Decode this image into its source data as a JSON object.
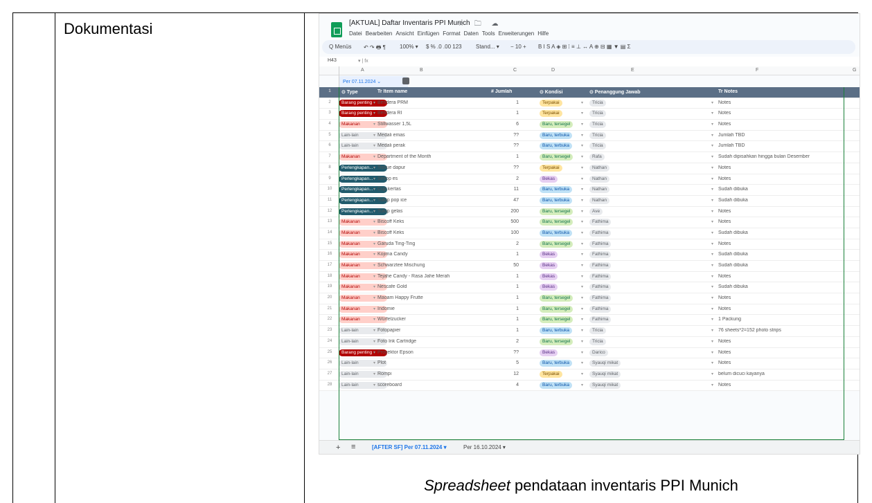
{
  "label": "Dokumentasi",
  "caption_italic": "Spreadsheet",
  "caption_rest": " pendataan inventaris PPI Munich",
  "sheet": {
    "title": "[AKTUAL] Daftar Inventaris PPI Munich",
    "title_icons": "☆ 🗀 ☁",
    "menu": [
      "Datei",
      "Bearbeiten",
      "Ansicht",
      "Einfügen",
      "Format",
      "Daten",
      "Tools",
      "Erweiterungen",
      "Hilfe"
    ],
    "toolbar": {
      "search": "Q Menüs",
      "undo": "↶ ↷ 🖶 ¶",
      "zoom": "100% ▾",
      "fmt": "$ % .0 .00 123",
      "font": "Stand... ▾",
      "size": "− 10 +",
      "style": "B I S A ◈ ⊞ ⁞ ≡ ⊥ ↔ A ⊕ ⊟ ▦ ▼ ▤ Σ"
    },
    "cell_ref": "H43",
    "fx": "▾ | fx",
    "col_letters": [
      "A",
      "B",
      "C",
      "D",
      "E",
      "F",
      "G"
    ],
    "tab_chip": "Per 07.11.2024 ⌄",
    "headers": {
      "type": "⊙ Type",
      "item": "Tr Item name",
      "jumlah": "# Jumlah",
      "kondisi": "⊙ Kondisi",
      "pj": "⊙ Penanggung Jawab",
      "notes": "Tr Notes"
    },
    "rows": [
      {
        "n": "2",
        "type": "Barang penting",
        "item": "Bendera PRM",
        "jml": "1",
        "kond": "Terpakai",
        "pj": "Tricia",
        "notes": "Notes"
      },
      {
        "n": "3",
        "type": "Barang penting",
        "item": "Bendera RI",
        "jml": "1",
        "kond": "Terpakai",
        "pj": "Tricia",
        "notes": "Notes"
      },
      {
        "n": "4",
        "type": "Makanan",
        "item": "Stillwasser 1,5L",
        "jml": "6",
        "kond": "Baru, tersegel",
        "pj": "Tricia",
        "notes": "Notes"
      },
      {
        "n": "5",
        "type": "Lain-lain",
        "item": "Medali emas",
        "jml": "??",
        "kond": "Baru, terbuka",
        "pj": "Tricia",
        "notes": "Jumlah TBD"
      },
      {
        "n": "6",
        "type": "Lain-lain",
        "item": "Medali perak",
        "jml": "??",
        "kond": "Baru, terbuka",
        "pj": "Tricia",
        "notes": "Jumlah TBD"
      },
      {
        "n": "7",
        "type": "Makanan",
        "item": "Department of the Month",
        "jml": "1",
        "kond": "Baru, tersegel",
        "pj": "Rafa",
        "notes": "Sudah dipisahkan hingga bulan Desember"
      },
      {
        "n": "8",
        "type": "Perlengkapan...",
        "item": "Tissue dapur",
        "jml": "??",
        "kond": "Terpakai",
        "pj": "Nathan",
        "notes": "Notes"
      },
      {
        "n": "9",
        "type": "Perlengkapan...",
        "item": "Sekop es",
        "jml": "2",
        "kond": "Bekas",
        "pj": "Nathan",
        "notes": "Notes"
      },
      {
        "n": "10",
        "type": "Perlengkapan...",
        "item": "Cup kertas",
        "jml": "11",
        "kond": "Baru, terbuka",
        "pj": "Nathan",
        "notes": "Sudah dibuka"
      },
      {
        "n": "11",
        "type": "Perlengkapan...",
        "item": "Tutup pop ice",
        "jml": "47",
        "kond": "Baru, terbuka",
        "pj": "Nathan",
        "notes": "Sudah dibuka"
      },
      {
        "n": "12",
        "type": "Perlengkapan...",
        "item": "Tutup gelas",
        "jml": "200",
        "kond": "Baru, tersegel",
        "pj": "Ave",
        "notes": "Notes"
      },
      {
        "n": "13",
        "type": "Makanan",
        "item": "Biscoff Keks",
        "jml": "500",
        "kond": "Baru, tersegel",
        "pj": "Fathima",
        "notes": "Notes"
      },
      {
        "n": "14",
        "type": "Makanan",
        "item": "Biscoff Keks",
        "jml": "100",
        "kond": "Baru, terbuka",
        "pj": "Fathima",
        "notes": "Sudah dibuka"
      },
      {
        "n": "15",
        "type": "Makanan",
        "item": "Garuda Ting-Ting",
        "jml": "2",
        "kond": "Baru, tersegel",
        "pj": "Fathima",
        "notes": "Notes"
      },
      {
        "n": "16",
        "type": "Makanan",
        "item": "Kojima Candy",
        "jml": "1",
        "kond": "Bekas",
        "pj": "Fathima",
        "notes": "Sudah dibuka"
      },
      {
        "n": "17",
        "type": "Makanan",
        "item": "Schwarztee Mischung",
        "jml": "50",
        "kond": "Bekas",
        "pj": "Fathima",
        "notes": "Sudah dibuka"
      },
      {
        "n": "18",
        "type": "Makanan",
        "item": "Tejahe Candy - Rasa Jahe Merah",
        "jml": "1",
        "kond": "Bekas",
        "pj": "Fathima",
        "notes": "Notes"
      },
      {
        "n": "19",
        "type": "Makanan",
        "item": "Nescafe Gold",
        "jml": "1",
        "kond": "Bekas",
        "pj": "Fathima",
        "notes": "Sudah dibuka"
      },
      {
        "n": "20",
        "type": "Makanan",
        "item": "Maoam Happy Frutte",
        "jml": "1",
        "kond": "Baru, tersegel",
        "pj": "Fathima",
        "notes": "Notes"
      },
      {
        "n": "21",
        "type": "Makanan",
        "item": "Indomie",
        "jml": "1",
        "kond": "Baru, tersegel",
        "pj": "Fathima",
        "notes": "Notes"
      },
      {
        "n": "22",
        "type": "Makanan",
        "item": "Würfelzucker",
        "jml": "1",
        "kond": "Baru, tersegel",
        "pj": "Fathima",
        "notes": "1 Packung"
      },
      {
        "n": "23",
        "type": "Lain-lain",
        "item": "Fotopapier",
        "jml": "1",
        "kond": "Baru, terbuka",
        "pj": "Tricia",
        "notes": "76 sheets*2=152 photo strips"
      },
      {
        "n": "24",
        "type": "Lain-lain",
        "item": "Foto Ink Cartridge",
        "jml": "2",
        "kond": "Baru, tersegel",
        "pj": "Tricia",
        "notes": "Notes"
      },
      {
        "n": "25",
        "type": "Barang penting",
        "item": "Proyektor Epson",
        "jml": "??",
        "kond": "Bekas",
        "pj": "Darico",
        "notes": "Notes"
      },
      {
        "n": "26",
        "type": "Lain-lain",
        "item": "Plot",
        "jml": "5",
        "kond": "Baru, terbuka",
        "pj": "Syauqi mikat",
        "notes": "Notes"
      },
      {
        "n": "27",
        "type": "Lain-lain",
        "item": "Rompi",
        "jml": "12",
        "kond": "Terpakai",
        "pj": "Syauqi mikat",
        "notes": "belum dicuci kayanya"
      },
      {
        "n": "28",
        "type": "Lain-lain",
        "item": "scoreboard",
        "jml": "4",
        "kond": "Baru, terbuka",
        "pj": "Syauqi mikat",
        "notes": "Notes"
      }
    ],
    "tabs": {
      "plus": "+",
      "list": "≡",
      "tab1": "[AFTER SF] Per 07.11.2024 ▾",
      "tab2": "Per 16.10.2024 ▾"
    }
  }
}
